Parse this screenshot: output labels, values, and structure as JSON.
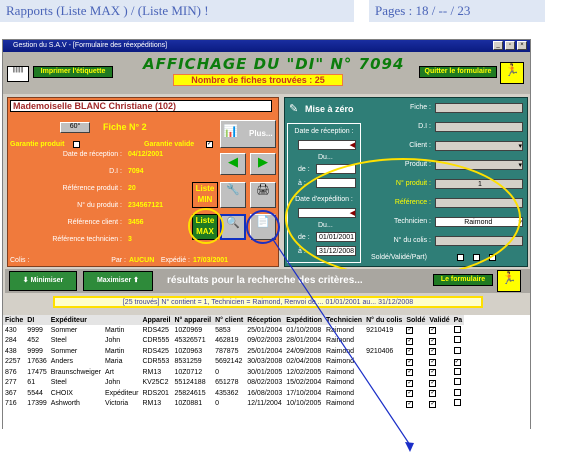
{
  "top": {
    "left": "Rapports  (Liste MAX ) /  (Liste MIN) !",
    "right": "Pages : 18 / -- / 23"
  },
  "window": {
    "title": "Gestion du S.A.V - [Formulaire des réexpéditions]",
    "min": "_",
    "restore": "▫",
    "close": "×"
  },
  "header": {
    "print_label": "Imprimer l'étiquette",
    "title": "AFFICHAGE DU \"DI\" N° 7094",
    "count": "Nombre de fiches trouvées : 25",
    "quit_label": "Quitter le formulaire"
  },
  "left": {
    "name": "Mademoiselle  BLANC  Christiane  (102)",
    "angle": "60°",
    "fiche": "Fiche N° 2",
    "garantie_produit": "Garantie produit",
    "garantie_valide": "Garantie valide",
    "fields": [
      {
        "label": "Date de réception :",
        "value": "04/12/2001"
      },
      {
        "label": "D.I :",
        "value": "7094"
      },
      {
        "label": "Référence produit :",
        "value": "20"
      },
      {
        "label": "N° du produit :",
        "value": "234567121"
      },
      {
        "label": "Référence client :",
        "value": "3456"
      },
      {
        "label": "Référence technicien :",
        "value": "3"
      }
    ],
    "colis": "Colis :",
    "par_label": "Par :",
    "par_value": "AUCUN",
    "expedie_label": "Expédié :",
    "expedie_value": "17/03/2001",
    "plus": "Plus...",
    "liste_min": "Liste MIN",
    "liste_max": "Liste MAX"
  },
  "right": {
    "reset": "Mise à zéro",
    "date_rec": "Date de réception :",
    "du": "Du...",
    "de": "de :",
    "a": "à :",
    "date_exp": "Date d'expédition :",
    "exp_de": "01/01/2001",
    "exp_a": "31/12/2008",
    "fiche": "Fiche :",
    "di": "D.I :",
    "client": "Client :",
    "produit": "Produit :",
    "n_produit": "N° produit :",
    "n_produit_val": "1",
    "reference": "Référence :",
    "technicien": "Technicien :",
    "technicien_val": "Raimond",
    "n_colis": "N° du colis :",
    "solde": "Soldé/Validé/Part)"
  },
  "bar": {
    "minimiser": "Minimiser",
    "maximiser": "Maximiser",
    "results": "résultats pour la recherche des critères...",
    "formulaire": "Le formulaire"
  },
  "criteria": "[25 trouvés]  N° contient = 1,  Technicien = Raimond, Renvoi de ... 01/01/2001  au... 31/12/2008",
  "table": {
    "headers": [
      "Fiche",
      "DI",
      "Expéditeur",
      "",
      "Appareil",
      "N° appareil",
      "N° client",
      "Réception",
      "Expédition",
      "Technicien",
      "N° du colis",
      "Soldé",
      "Validé",
      "Pa"
    ],
    "rows": [
      [
        "430",
        "9999",
        "Sommer",
        "Martin",
        "RDS425",
        "10Z0969",
        "5853",
        "25/01/2004",
        "01/10/2008",
        "Raimond",
        "9210419",
        "x",
        "x",
        ""
      ],
      [
        "284",
        "452",
        "Steel",
        "John",
        "CDR555",
        "45326571",
        "462819",
        "09/02/2003",
        "28/01/2004",
        "Raimond",
        "",
        "x",
        "x",
        ""
      ],
      [
        "438",
        "9999",
        "Sommer",
        "Martin",
        "RDS425",
        "10Z0963",
        "787875",
        "25/01/2004",
        "24/09/2008",
        "Raimond",
        "9210406",
        "x",
        "x",
        ""
      ],
      [
        "2257",
        "17636",
        "Anders",
        "Maria",
        "CDR553",
        "8531259",
        "5692142",
        "30/03/2008",
        "02/04/2008",
        "Raimond",
        "",
        "x",
        "x",
        "x"
      ],
      [
        "876",
        "17475",
        "Braunschweiger",
        "Art",
        "RM13",
        "10Z0712",
        "0",
        "30/01/2005",
        "12/02/2005",
        "Raimond",
        "",
        "x",
        "x",
        ""
      ],
      [
        "277",
        "61",
        "Steel",
        "John",
        "KV25C2",
        "55124188",
        "651278",
        "08/02/2003",
        "15/02/2004",
        "Raimond",
        "",
        "x",
        "x",
        ""
      ],
      [
        "367",
        "5544",
        "CHOIX",
        "Expéditeur",
        "RDS201",
        "25824615",
        "435362",
        "16/08/2003",
        "17/10/2004",
        "Raimond",
        "",
        "x",
        "x",
        ""
      ],
      [
        "716",
        "17399",
        "Ashworth",
        "Victoria",
        "RM13",
        "10Z0881",
        "0",
        "12/11/2004",
        "10/10/2005",
        "Raimond",
        "",
        "x",
        "x",
        ""
      ]
    ]
  },
  "colors": {
    "orange": "#f07a3c",
    "teal": "#2f7e77",
    "green": "#1f7a22",
    "yellow": "#ffff00"
  }
}
